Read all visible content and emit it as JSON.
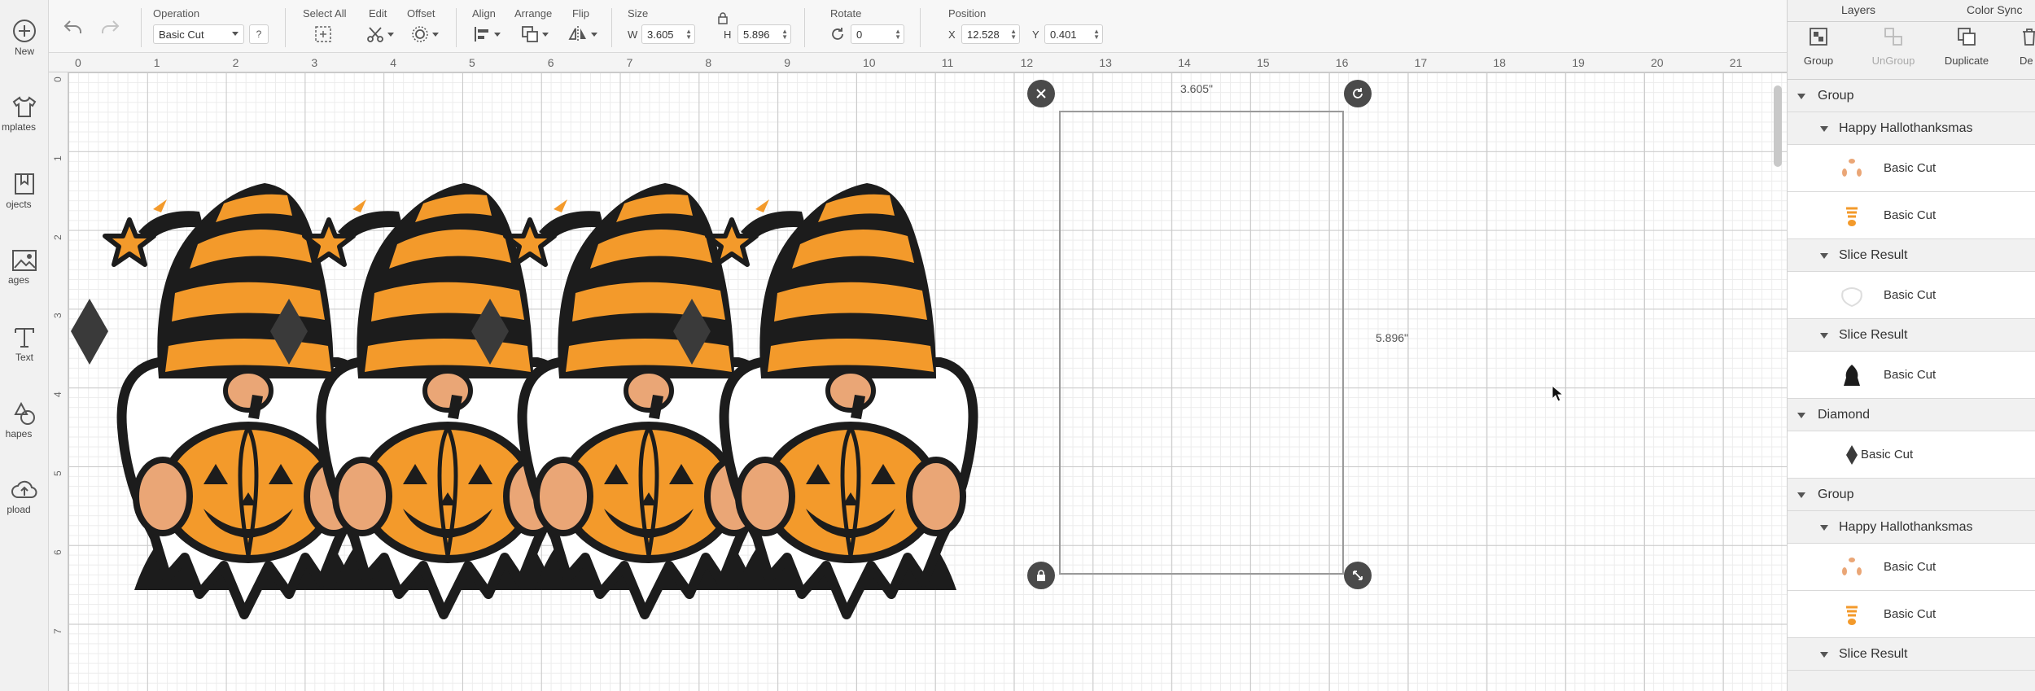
{
  "left_bar": {
    "items": [
      {
        "label": "New",
        "icon": "plus-circle-icon"
      },
      {
        "label": "Templates",
        "icon": "shirt-icon"
      },
      {
        "label": "Projects",
        "icon": "bookmark-icon"
      },
      {
        "label": "Images",
        "icon": "image-icon"
      },
      {
        "label": "Text",
        "icon": "text-icon"
      },
      {
        "label": "Shapes",
        "icon": "shapes-icon"
      },
      {
        "label": "Upload",
        "icon": "cloud-upload-icon"
      }
    ],
    "visible_labels": [
      "New",
      "mplates",
      "ojects",
      "ages",
      "Text",
      "hapes",
      "pload"
    ]
  },
  "toolbar": {
    "undo_icon": "undo-icon",
    "redo_icon": "redo-icon",
    "operation_label": "Operation",
    "operation_value": "Basic Cut",
    "help_label": "?",
    "select_all_label": "Select All",
    "edit_label": "Edit",
    "offset_label": "Offset",
    "align_label": "Align",
    "arrange_label": "Arrange",
    "flip_label": "Flip",
    "size_label": "Size",
    "width_prefix": "W",
    "width_value": "3.605",
    "height_prefix": "H",
    "height_value": "5.896",
    "rotate_label": "Rotate",
    "rotate_value": "0",
    "position_label": "Position",
    "x_prefix": "X",
    "x_value": "12.528",
    "y_prefix": "Y",
    "y_value": "0.401"
  },
  "ruler": {
    "top": [
      "0",
      "1",
      "2",
      "3",
      "4",
      "5",
      "6",
      "7",
      "8",
      "9",
      "10",
      "11",
      "12",
      "13",
      "14",
      "15",
      "16",
      "17",
      "18",
      "19",
      "20",
      "21"
    ],
    "left": [
      "0",
      "1",
      "2",
      "3",
      "4",
      "5",
      "6",
      "7"
    ]
  },
  "selection": {
    "width_label": "3.605\"",
    "height_label": "5.896\""
  },
  "colors": {
    "orange": "#f39a2b",
    "black": "#1c1c1c",
    "skin": "#eaa676",
    "diamond": "#3a3a3a",
    "grid_major": "#c9c9c9",
    "grid_minor": "#ececec"
  },
  "right_panel": {
    "tabs": [
      "Layers",
      "Color Sync"
    ],
    "actions": [
      {
        "label": "Group",
        "icon": "group-icon",
        "enabled": true
      },
      {
        "label": "UnGroup",
        "icon": "ungroup-icon",
        "enabled": false
      },
      {
        "label": "Duplicate",
        "icon": "duplicate-icon",
        "enabled": true
      },
      {
        "label": "De",
        "icon": "delete-icon",
        "enabled": true
      }
    ],
    "layers": [
      {
        "label": "Group",
        "level": 0,
        "kind": "header"
      },
      {
        "label": "Happy Hallothanksmas",
        "level": 1,
        "kind": "header"
      },
      {
        "label": "Basic Cut",
        "level": 2,
        "kind": "item",
        "thumb": "nose-cheeks-thumb-icon"
      },
      {
        "label": "Basic Cut",
        "level": 2,
        "kind": "item",
        "thumb": "hat-stripes-thumb-icon"
      },
      {
        "label": "Slice Result",
        "level": 1,
        "kind": "header"
      },
      {
        "label": "Basic Cut",
        "level": 2,
        "kind": "item",
        "thumb": "beard-outline-thumb-icon"
      },
      {
        "label": "Slice Result",
        "level": 1,
        "kind": "header"
      },
      {
        "label": "Basic Cut",
        "level": 2,
        "kind": "item",
        "thumb": "gnome-silhouette-thumb-icon"
      },
      {
        "label": "Diamond",
        "level": 0,
        "kind": "header"
      },
      {
        "label": "Basic Cut",
        "level": 2,
        "kind": "item",
        "thumb": "diamond-thumb-icon"
      },
      {
        "label": "Group",
        "level": 0,
        "kind": "header"
      },
      {
        "label": "Happy Hallothanksmas",
        "level": 1,
        "kind": "header"
      },
      {
        "label": "Basic Cut",
        "level": 2,
        "kind": "item",
        "thumb": "nose-cheeks-thumb-icon"
      },
      {
        "label": "Basic Cut",
        "level": 2,
        "kind": "item",
        "thumb": "hat-stripes-thumb-icon"
      },
      {
        "label": "Slice Result",
        "level": 1,
        "kind": "header"
      }
    ]
  }
}
